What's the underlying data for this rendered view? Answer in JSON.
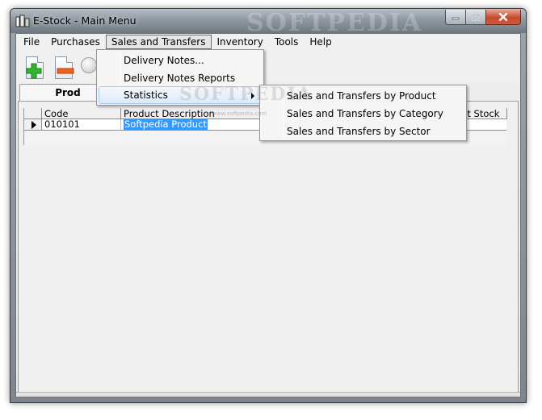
{
  "window": {
    "title": "E-Stock - Main Menu",
    "watermark": "SOFTPEDIA"
  },
  "menubar": {
    "items": [
      {
        "label": "File"
      },
      {
        "label": "Purchases"
      },
      {
        "label": "Sales and Transfers"
      },
      {
        "label": "Inventory"
      },
      {
        "label": "Tools"
      },
      {
        "label": "Help"
      }
    ]
  },
  "sales_menu": {
    "items": [
      {
        "label": "Delivery Notes..."
      },
      {
        "label": "Delivery Notes Reports"
      },
      {
        "label": "Statistics"
      }
    ]
  },
  "statistics_submenu": {
    "items": [
      {
        "label": "Sales and Transfers by Product"
      },
      {
        "label": "Sales and Transfers by Category"
      },
      {
        "label": "Sales and Transfers by Sector"
      }
    ]
  },
  "tabs": {
    "active_label": "Prod"
  },
  "grid": {
    "columns": [
      "Code",
      "Product Description",
      "ent Stock"
    ],
    "rows": [
      {
        "code": "010101",
        "description": "Softpedia Product"
      }
    ]
  },
  "overlay": {
    "watermark": "SOFTPEDIA",
    "watermark_url": "www.softpedia.com"
  },
  "colors": {
    "accent_selection": "#3399ff",
    "add_green": "#2fb52f",
    "remove_orange": "#f06020"
  },
  "icons": {
    "add": "add-document-icon",
    "remove": "remove-document-icon",
    "app": "app-icon"
  }
}
